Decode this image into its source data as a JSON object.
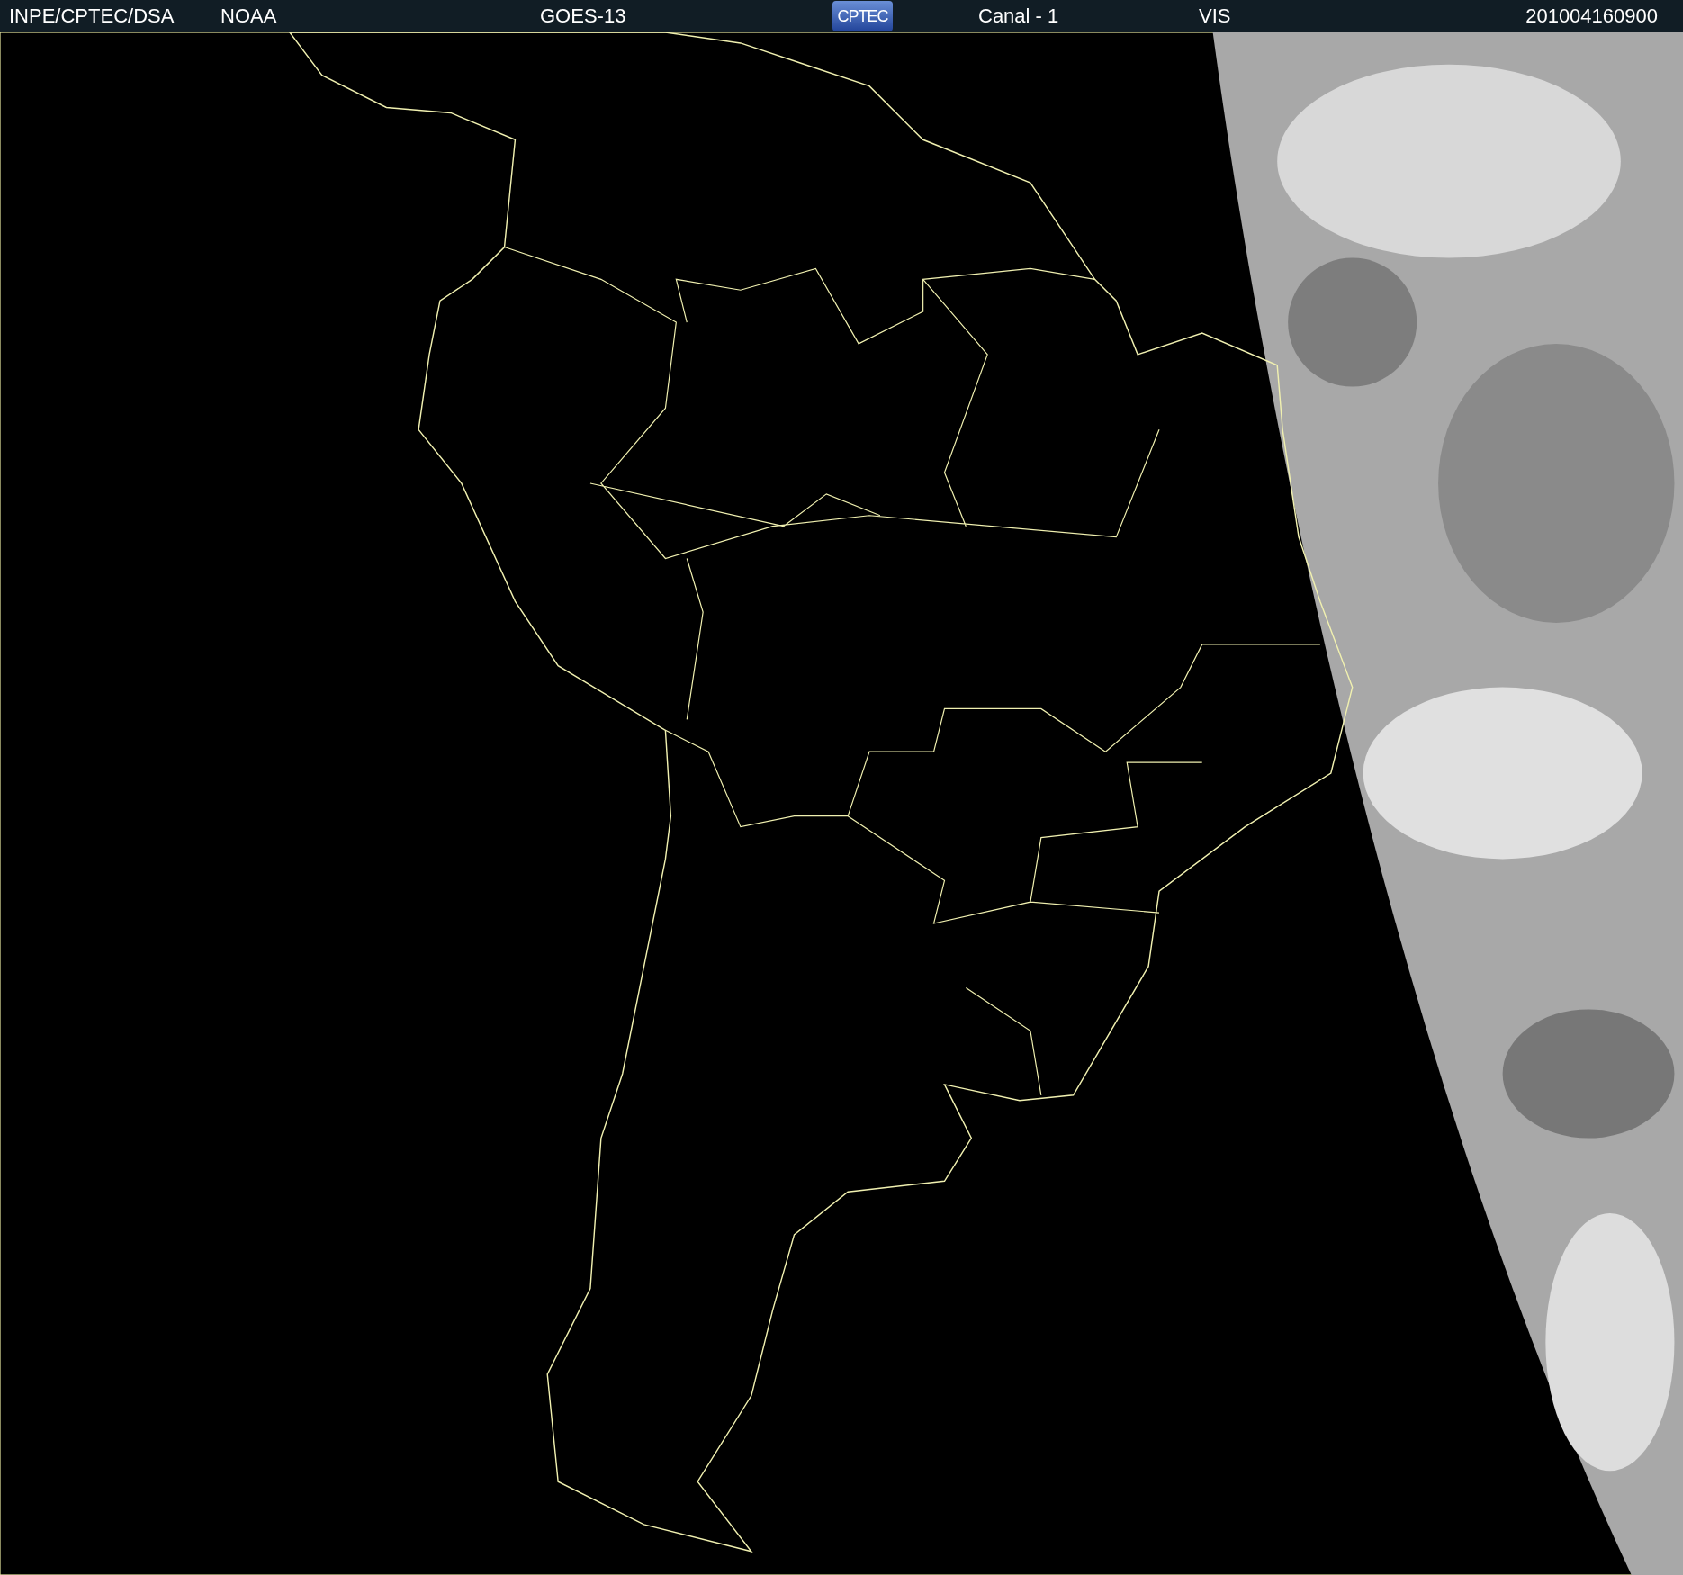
{
  "header": {
    "source": "INPE/CPTEC/DSA",
    "agency": "NOAA",
    "satellite": "GOES-13",
    "logo": "CPTEC",
    "channel": "Canal - 1",
    "band": "VIS",
    "timestamp": "201004160900"
  }
}
